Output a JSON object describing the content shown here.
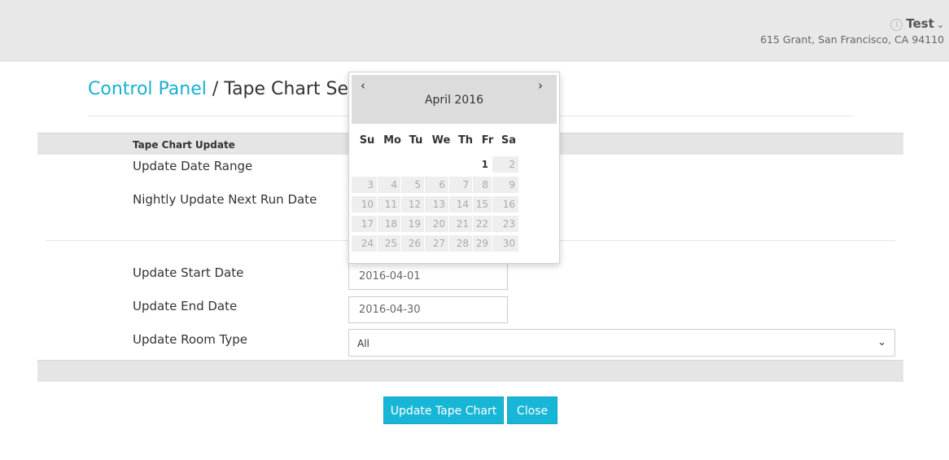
{
  "header": {
    "user_name": "Test",
    "address": "615 Grant, San Francisco, CA 94110"
  },
  "page": {
    "breadcrumb_link": "Control Panel",
    "breadcrumb_sep": " / ",
    "title_visible": "Tape Chart Se"
  },
  "form": {
    "section_title": "Tape Chart Update",
    "update_date_range_label": "Update Date Range",
    "nightly_next_run_label": "Nightly Update Next Run Date",
    "start_date_label": "Update Start Date",
    "start_date_value": "2016-04-01",
    "end_date_label": "Update End Date",
    "end_date_value": "2016-04-30",
    "room_type_label": "Update Room Type",
    "room_type_value": "All"
  },
  "buttons": {
    "update": "Update Tape Chart",
    "close": "Close"
  },
  "datepicker": {
    "prev": "‹",
    "next": "›",
    "month_title": "April 2016",
    "weekdays": [
      "Su",
      "Mo",
      "Tu",
      "We",
      "Th",
      "Fr",
      "Sa"
    ],
    "weeks": [
      [
        "",
        "",
        "",
        "",
        "",
        "1",
        "2"
      ],
      [
        "3",
        "4",
        "5",
        "6",
        "7",
        "8",
        "9"
      ],
      [
        "10",
        "11",
        "12",
        "13",
        "14",
        "15",
        "16"
      ],
      [
        "17",
        "18",
        "19",
        "20",
        "21",
        "22",
        "23"
      ],
      [
        "24",
        "25",
        "26",
        "27",
        "28",
        "29",
        "30"
      ]
    ],
    "enabled_day": "1"
  },
  "colors": {
    "accent": "#1ab0cf",
    "button_bg": "#18b6d6"
  }
}
